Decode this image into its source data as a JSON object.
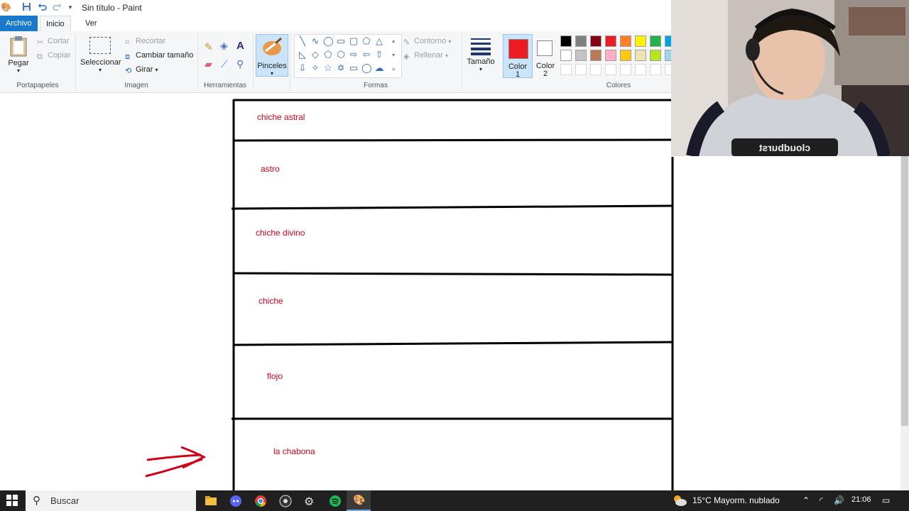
{
  "window": {
    "title": "Sin título - Paint"
  },
  "tabs": [
    {
      "label": "Archivo"
    },
    {
      "label": "Inicio"
    },
    {
      "label": "Ver"
    }
  ],
  "ribbon": {
    "portapapeles": {
      "group": "Portapapeles",
      "paste": "Pegar",
      "cut": "Cortar",
      "copy": "Copiar"
    },
    "imagen": {
      "group": "Imagen",
      "select": "Seleccionar",
      "crop": "Recortar",
      "resize": "Cambiar tamaño",
      "rotate": "Girar"
    },
    "herramientas": {
      "group": "Herramientas"
    },
    "pinceles": {
      "label": "Pinceles"
    },
    "formas": {
      "group": "Formas",
      "outline": "Contorno",
      "fill": "Rellenar"
    },
    "tamano": {
      "label": "Tamaño"
    },
    "color1": {
      "label": "Color",
      "num": "1",
      "value": "#ed1c24"
    },
    "color2": {
      "label": "Color",
      "num": "2",
      "value": "#ffffff"
    },
    "colores": {
      "group": "Colores"
    },
    "palette_row1": [
      "#000000",
      "#7f7f7f",
      "#880015",
      "#ed1c24",
      "#ff7f27",
      "#fff200",
      "#22b14c",
      "#00a2e8"
    ],
    "palette_row2": [
      "#ffffff",
      "#c3c3c3",
      "#b97a57",
      "#ffaec9",
      "#ffc90e",
      "#efe4b0",
      "#b5e61d",
      "#99d9ea"
    ]
  },
  "canvas": {
    "rows": [
      {
        "text": "chiche astral"
      },
      {
        "text": "astro"
      },
      {
        "text": "chiche divino"
      },
      {
        "text": "chiche"
      },
      {
        "text": "flojo"
      },
      {
        "text": "la chabona"
      }
    ]
  },
  "webcam": {
    "shirt_text": "cloudburst"
  },
  "taskbar": {
    "search_placeholder": "Buscar",
    "weather": "15°C  Mayorm. nublado",
    "time": "21:06"
  }
}
